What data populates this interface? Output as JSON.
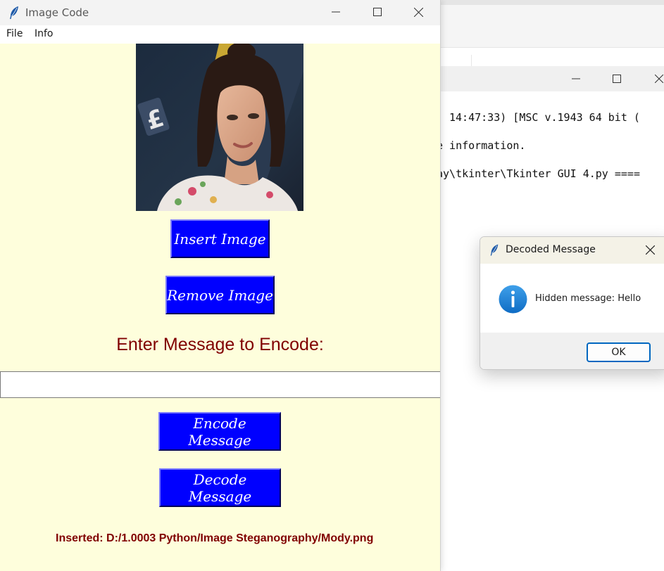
{
  "main_window": {
    "title": "Image Code",
    "menu": [
      "File",
      "Info"
    ],
    "insert_button": "Insert Image",
    "remove_button": "Remove Image",
    "prompt_label": "Enter Message to Encode:",
    "message_input_value": "",
    "encode_button": "Encode Message",
    "decode_button": "Decode Message",
    "status": "Inserted: D:/1.0003 Python/Image Steganography/Mody.png"
  },
  "background_shell": {
    "lines": [
      "14:47:33) [MSC v.1943 64 bit (",
      "e information.",
      "ay\\tkinter\\Tkinter GUI 4.py ===="
    ]
  },
  "dialog": {
    "title": "Decoded Message",
    "message": "Hidden message: Hello",
    "ok_label": "OK"
  },
  "colors": {
    "window_bg": "#fefedc",
    "button_bg": "#0000ff",
    "button_text": "#ffffff",
    "label_text": "#800000",
    "ok_border": "#0067c0",
    "info_icon": "#1a7fd4"
  },
  "icons": [
    "feather-icon",
    "minimize-icon",
    "maximize-icon",
    "close-icon",
    "info-icon"
  ]
}
